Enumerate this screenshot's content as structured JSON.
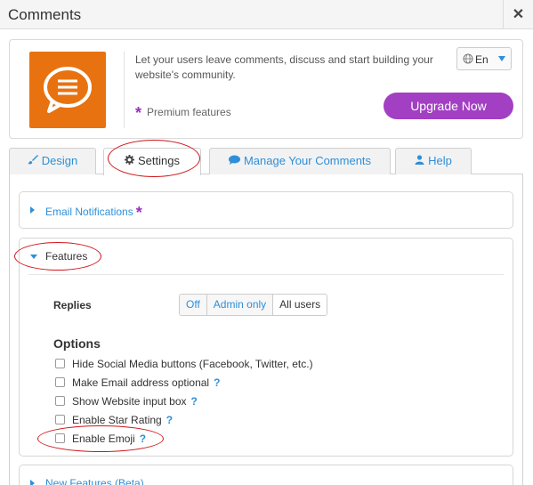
{
  "window": {
    "title": "Comments",
    "close_symbol": "✕"
  },
  "header": {
    "description": "Let your users leave comments, discuss and start building your website's community.",
    "premium_star": "*",
    "premium_label": "Premium features",
    "language": "En",
    "upgrade_label": "Upgrade Now"
  },
  "tabs": [
    {
      "label": "Design",
      "icon": "brush-icon"
    },
    {
      "label": "Settings",
      "icon": "gear-icon"
    },
    {
      "label": "Manage Your Comments",
      "icon": "chat-icon"
    },
    {
      "label": "Help",
      "icon": "user-icon"
    }
  ],
  "sections": {
    "email": {
      "label": "Email Notifications",
      "premium_star": "*"
    },
    "features": {
      "label": "Features"
    },
    "new_features": {
      "label": "New Features (Beta)"
    }
  },
  "replies": {
    "label": "Replies",
    "options": [
      "Off",
      "Admin only",
      "All users"
    ],
    "selected": "All users"
  },
  "options": {
    "title": "Options",
    "help_symbol": "?",
    "items": [
      {
        "label": "Hide Social Media buttons (Facebook, Twitter, etc.)",
        "checked": false,
        "help": false
      },
      {
        "label": "Make Email address optional",
        "checked": false,
        "help": true
      },
      {
        "label": "Show Website input box",
        "checked": false,
        "help": true
      },
      {
        "label": "Enable Star Rating",
        "checked": false,
        "help": true
      },
      {
        "label": "Enable Emoji",
        "checked": false,
        "help": true
      }
    ]
  },
  "colors": {
    "accent_blue": "#2f8fd8",
    "brand_orange": "#e8720f",
    "premium_purple": "#a23fc3",
    "annotation_red": "#d0161b"
  }
}
